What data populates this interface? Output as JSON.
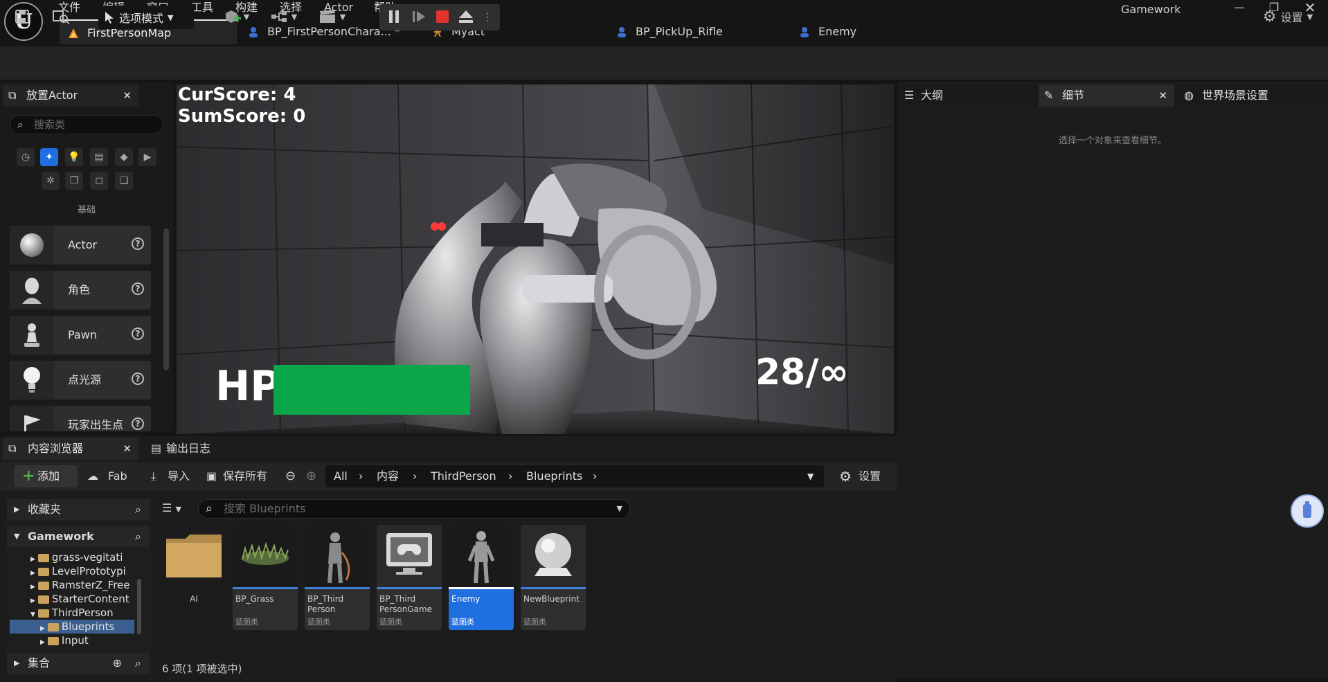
{
  "app": {
    "logo": "U",
    "project_name": "Gamework",
    "menu": [
      "文件",
      "编辑",
      "窗口",
      "工具",
      "构建",
      "选择",
      "Actor",
      "帮助"
    ],
    "window_controls": [
      "—",
      "❐",
      "✕"
    ]
  },
  "doc_tabs": [
    {
      "label": "FirstPersonMap",
      "icon": "map-icon",
      "active": true
    },
    {
      "label": "BP_FirstPersonChara... *",
      "icon": "blueprint-icon",
      "active": false
    },
    {
      "label": "Myact",
      "icon": "actor-icon",
      "active": false
    },
    {
      "label": "BP_PickUp_Rifle",
      "icon": "blueprint-icon",
      "active": false
    },
    {
      "label": "Enemy",
      "icon": "blueprint-icon",
      "active": false
    }
  ],
  "toolbar": {
    "mode_label": "选项模式",
    "settings_label": "设置"
  },
  "place_actor": {
    "tab_label": "放置Actor",
    "search_placeholder": "搜索类",
    "category_label": "基础",
    "items": [
      {
        "label": "Actor",
        "icon": "sphere-icon"
      },
      {
        "label": "角色",
        "icon": "character-icon"
      },
      {
        "label": "Pawn",
        "icon": "pawn-icon"
      },
      {
        "label": "点光源",
        "icon": "point-light-icon"
      },
      {
        "label": "玩家出生点",
        "icon": "player-start-icon"
      }
    ]
  },
  "viewport": {
    "cur_score_label": "CurScore: 4",
    "sum_score_label": "SumScore: 0",
    "hp_label": "HP",
    "hp_fraction": 1.0,
    "hp_color": "#0aa64a",
    "ammo_label": "28/∞"
  },
  "right_panel": {
    "tabs": [
      "大纲",
      "细节",
      "世界场景设置"
    ],
    "details_empty": "选择一个对象来查看细节。"
  },
  "content_browser": {
    "tab_label": "内容浏览器",
    "log_tab_label": "输出日志",
    "add_label": "添加",
    "fab_label": "Fab",
    "import_label": "导入",
    "save_all_label": "保存所有",
    "settings_label": "设置",
    "breadcrumb": [
      "All",
      "内容",
      "ThirdPerson",
      "Blueprints"
    ],
    "favorites_label": "收藏夹",
    "project_label": "Gamework",
    "collections_label": "集合",
    "tree": [
      {
        "label": "grass-vegitati"
      },
      {
        "label": "LevelPrototypi"
      },
      {
        "label": "RamsterZ_Free"
      },
      {
        "label": "StarterContent"
      },
      {
        "label": "ThirdPerson"
      },
      {
        "label": "Blueprints"
      },
      {
        "label": "Input"
      }
    ],
    "search_placeholder": "搜索 Blueprints",
    "assets": [
      {
        "name": "AI",
        "type": ""
      },
      {
        "name": "BP_Grass",
        "type": "蓝图类"
      },
      {
        "name": "BP_Third Person",
        "type": "蓝图类"
      },
      {
        "name": "BP_Third PersonGame",
        "type": "蓝图类"
      },
      {
        "name": "Enemy",
        "type": "蓝图类"
      },
      {
        "name": "NewBlueprint",
        "type": "蓝图类"
      }
    ],
    "status": "6 项(1 项被选中)"
  },
  "colors": {
    "accent_blue": "#1f6fe0",
    "hp_green": "#0aa64a",
    "stop_red": "#e0342c"
  }
}
